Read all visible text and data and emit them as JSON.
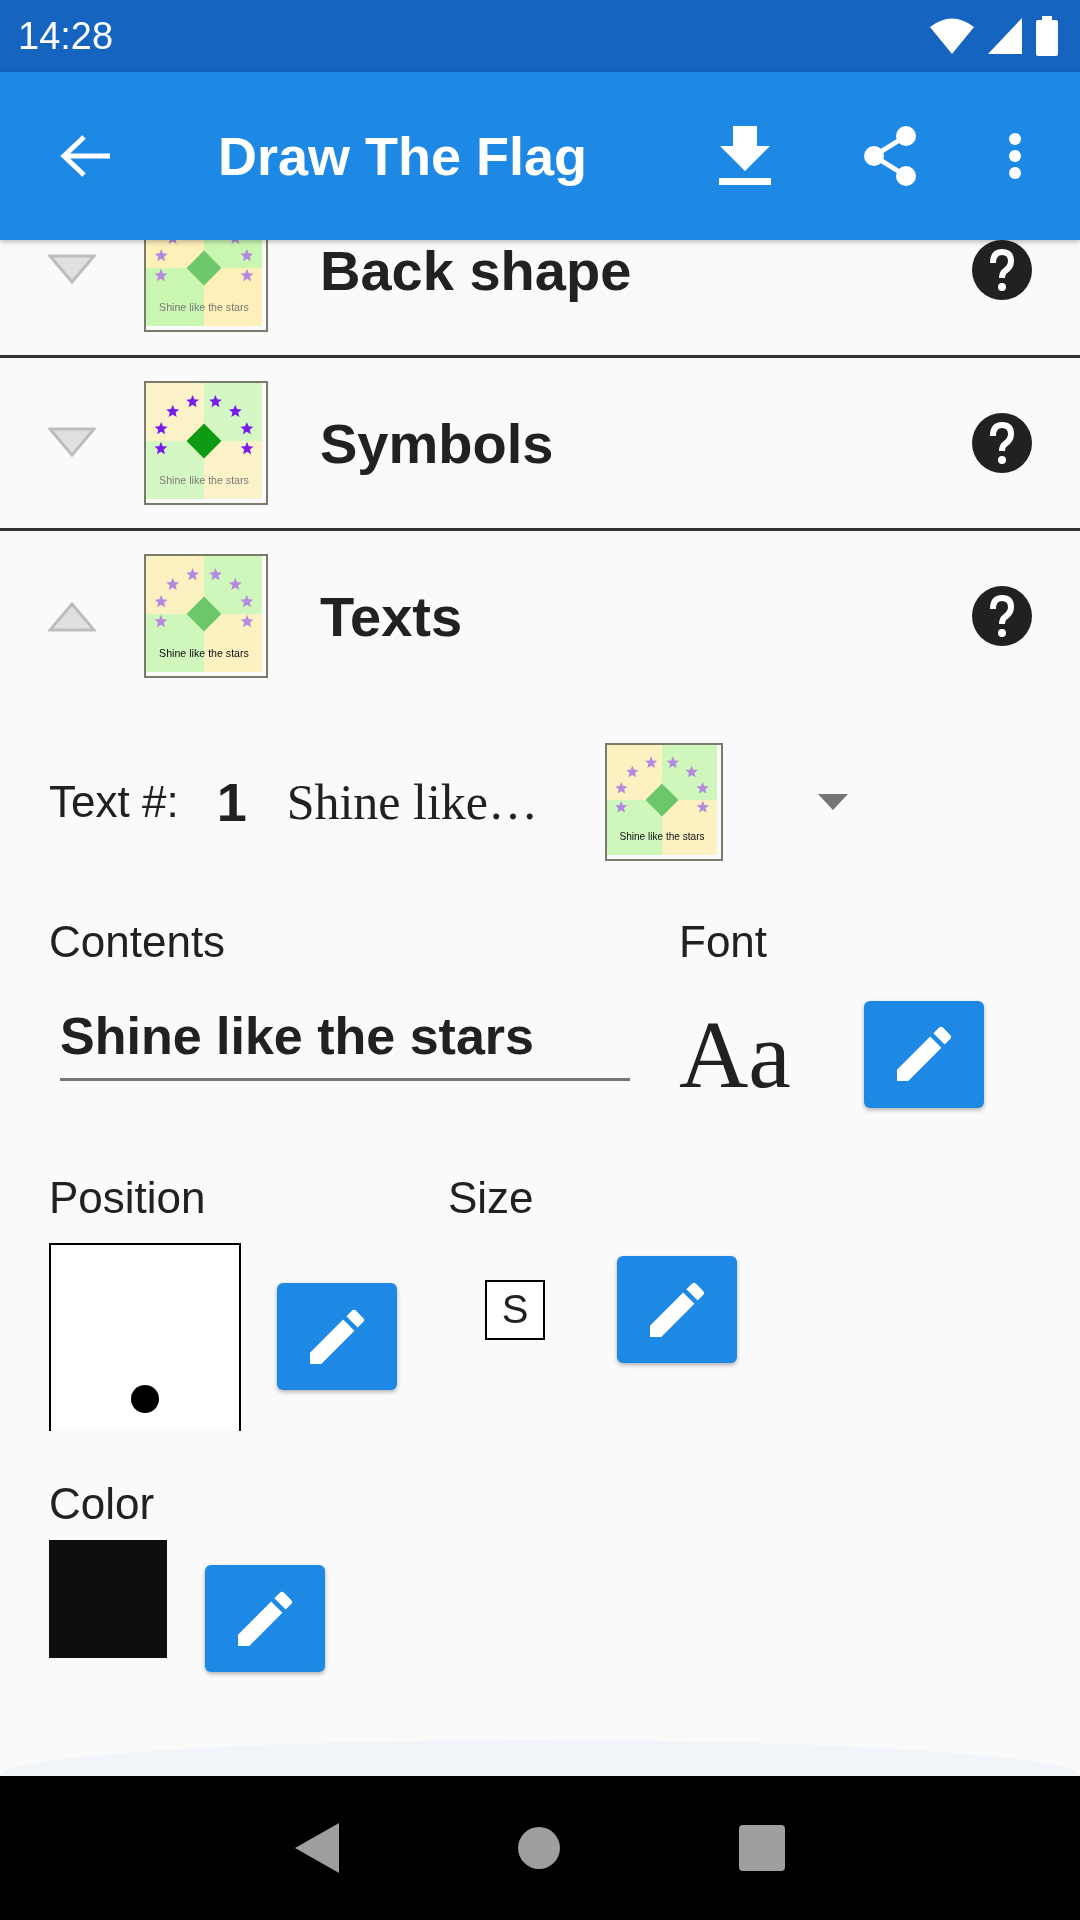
{
  "status_bar": {
    "time": "14:28"
  },
  "app_bar": {
    "title": "Draw The Flag"
  },
  "sections": [
    {
      "title": "Back shape",
      "expanded": false,
      "thumbnail": {
        "kind": "shape",
        "caption": "Shine like the stars"
      }
    },
    {
      "title": "Symbols",
      "expanded": false,
      "thumbnail": {
        "kind": "symbols",
        "caption": "Shine like the stars"
      }
    },
    {
      "title": "Texts",
      "expanded": true,
      "thumbnail": {
        "kind": "texts",
        "caption": "Shine like the stars"
      }
    }
  ],
  "text_editor": {
    "selector": {
      "label": "Text #:",
      "number": "1",
      "name": "Shine like…",
      "thumbnail": {
        "kind": "texts",
        "caption": "Shine like the stars"
      }
    },
    "contents": {
      "label": "Contents",
      "value": "Shine like the stars"
    },
    "font": {
      "label": "Font",
      "sample": "Aa"
    },
    "position": {
      "label": "Position"
    },
    "size": {
      "label": "Size",
      "value": "S"
    },
    "color": {
      "label": "Color",
      "color": "#0e0e0e"
    }
  }
}
